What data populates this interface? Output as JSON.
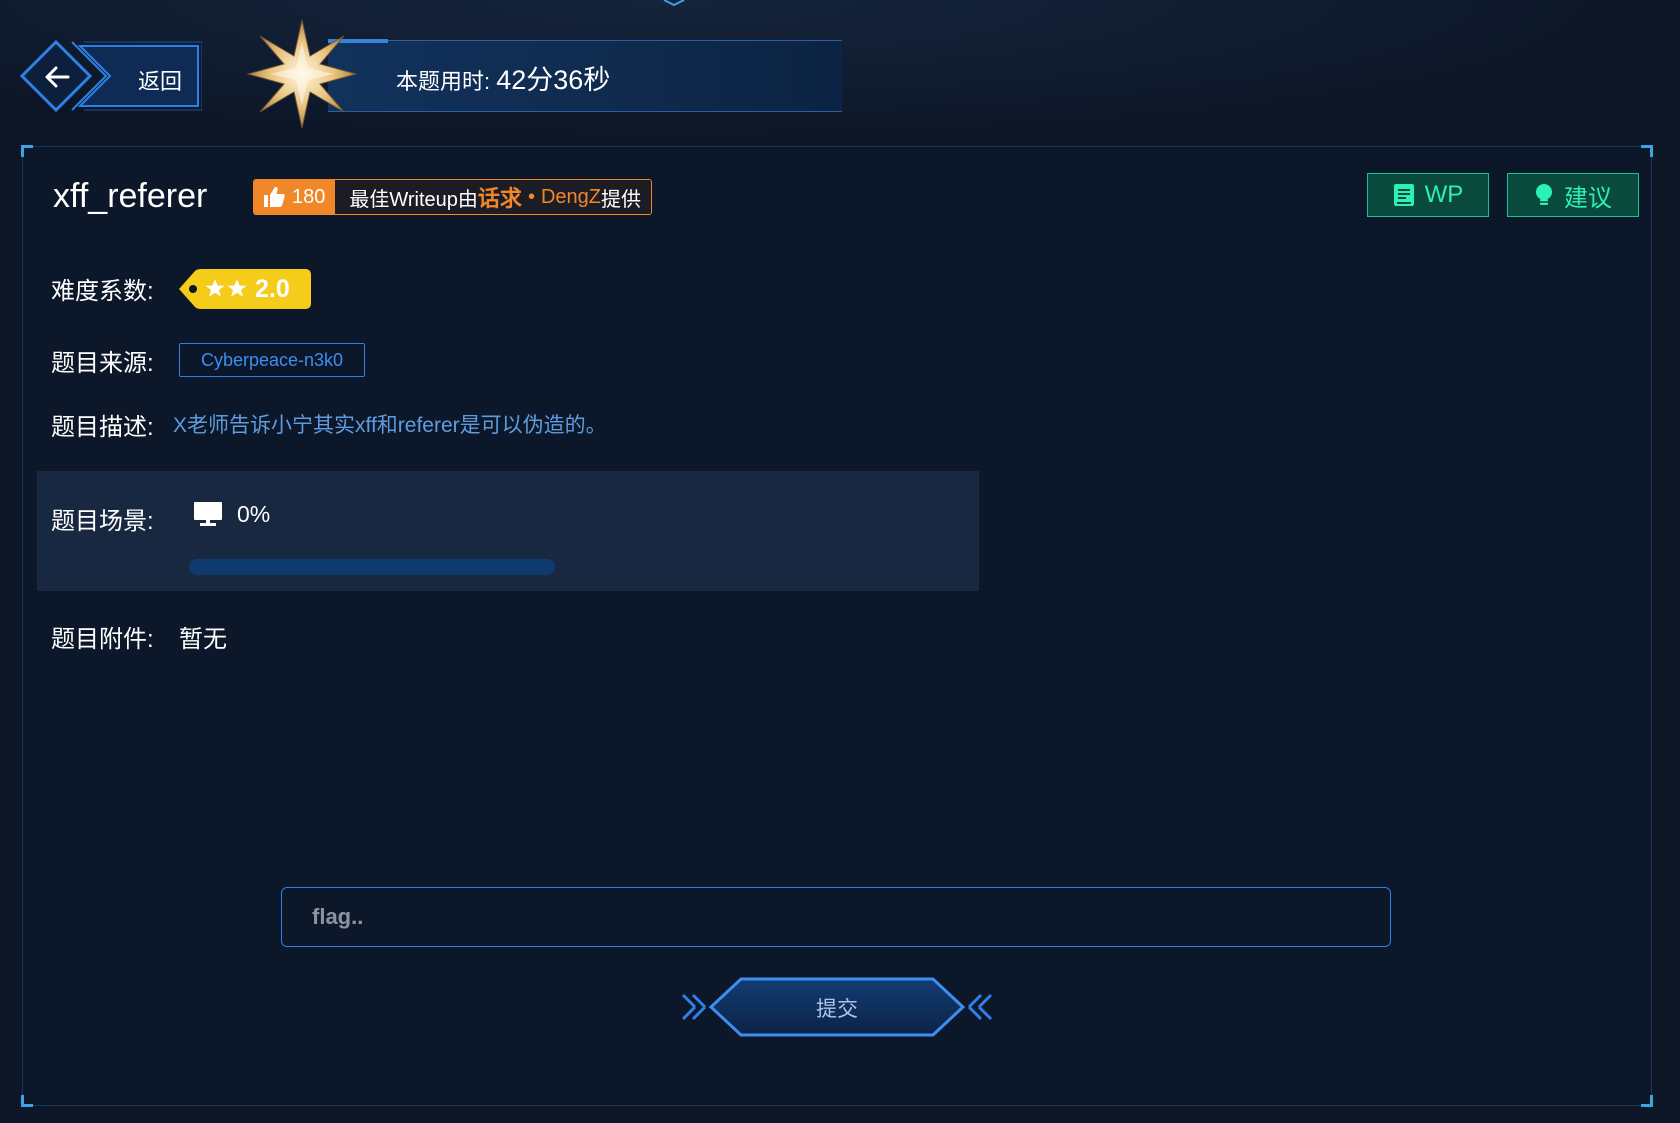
{
  "header": {
    "back_label": "返回",
    "timer_label": "本题用时:",
    "timer_value": "42分36秒"
  },
  "challenge": {
    "title": "xff_referer",
    "likes": "180",
    "writeup_prefix": "最佳Writeup由",
    "writeup_author": "话求",
    "writeup_dot": "•",
    "writeup_name": "DengZ",
    "writeup_suffix": "提供",
    "wp_button": "WP",
    "suggest_button": "建议"
  },
  "details": {
    "difficulty_label": "难度系数:",
    "difficulty_value": "2.0",
    "difficulty_stars": 2,
    "source_label": "题目来源:",
    "source_value": "Cyberpeace-n3k0",
    "description_label": "题目描述:",
    "description_value": "X老师告诉小宁其实xff和referer是可以伪造的。",
    "scene_label": "题目场景:",
    "scene_progress_text": "0%",
    "scene_progress": 0,
    "attachment_label": "题目附件:",
    "attachment_value": "暂无"
  },
  "submit": {
    "placeholder": "flag..",
    "button_label": "提交"
  },
  "colors": {
    "background": "#0c1627",
    "accent_blue": "#2e7fe6",
    "wp_orange": "#f0882a",
    "green_button": "#18c49a",
    "difficulty_yellow": "#f5cc1a"
  },
  "icons": {
    "back": "arrow-left-icon",
    "timer": "star-badge-icon",
    "like": "thumbs-up-icon",
    "wp": "document-icon",
    "suggest": "lightbulb-icon",
    "scene": "monitor-icon"
  }
}
